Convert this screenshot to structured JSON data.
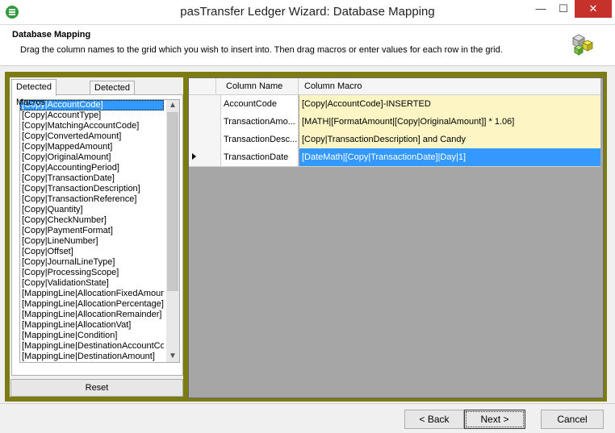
{
  "window": {
    "title": "pasTransfer Ledger Wizard: Database Mapping",
    "min_glyph": "—",
    "max_glyph": "☐",
    "close_glyph": "✕",
    "icon": "ledger-app-icon"
  },
  "header": {
    "title": "Database Mapping",
    "description": "Drag the column names to the grid which you wish to insert into.  Then drag macros or enter values for each row in the grid.",
    "icon": "database-cubes-icon"
  },
  "tabs": [
    {
      "label": "Detected Macros"
    },
    {
      "label": "Detected Columns"
    }
  ],
  "macros": [
    "[Copy|AccountCode]",
    "[Copy|AccountType]",
    "[Copy|MatchingAccountCode]",
    "[Copy|ConvertedAmount]",
    "[Copy|MappedAmount]",
    "[Copy|OriginalAmount]",
    "[Copy|AccountingPeriod]",
    "[Copy|TransactionDate]",
    "[Copy|TransactionDescription]",
    "[Copy|TransactionReference]",
    "[Copy|Quantity]",
    "[Copy|CheckNumber]",
    "[Copy|PaymentFormat]",
    "[Copy|LineNumber]",
    "[Copy|Offset]",
    "[Copy|JournalLineType]",
    "[Copy|ProcessingScope]",
    "[Copy|ValidationState]",
    "[MappingLine|AllocationFixedAmount]",
    "[MappingLine|AllocationPercentage]",
    "[MappingLine|AllocationRemainder]",
    "[MappingLine|AllocationVat]",
    "[MappingLine|Condition]",
    "[MappingLine|DestinationAccountCode]",
    "[MappingLine|DestinationAmount]"
  ],
  "selected_macro_index": 0,
  "reset_label": "Reset",
  "grid": {
    "headers": {
      "name": "Column Name",
      "macro": "Column Macro"
    },
    "rows": [
      {
        "name": "AccountCode",
        "macro": "[Copy|AccountCode]-INSERTED",
        "current": false
      },
      {
        "name": "TransactionAmo...",
        "macro": "[MATH|[FormatAmount|[Copy|OriginalAmount]] * 1.06]",
        "current": false
      },
      {
        "name": "TransactionDesc...",
        "macro": "[Copy|TransactionDescription] and Candy",
        "current": false
      },
      {
        "name": "TransactionDate",
        "macro": "[DateMath|[Copy|TransactionDate]|Day|1]",
        "current": true
      }
    ]
  },
  "buttons": {
    "back": "< Back",
    "next": "Next >",
    "cancel": "Cancel"
  }
}
